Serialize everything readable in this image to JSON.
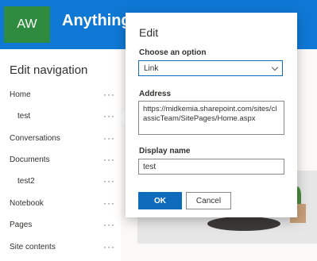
{
  "header": {
    "avatar_initials": "AW",
    "site_title": "Anything b"
  },
  "nav": {
    "title": "Edit navigation",
    "more_glyph": "···",
    "items": [
      {
        "label": "Home",
        "indent": false
      },
      {
        "label": "test",
        "indent": true
      },
      {
        "label": "Conversations",
        "indent": false
      },
      {
        "label": "Documents",
        "indent": false
      },
      {
        "label": "test2",
        "indent": true
      },
      {
        "label": "Notebook",
        "indent": false
      },
      {
        "label": "Pages",
        "indent": false
      },
      {
        "label": "Site contents",
        "indent": false
      }
    ]
  },
  "dialog": {
    "title": "Edit",
    "option_label": "Choose an option",
    "option_value": "Link",
    "address_label": "Address",
    "address_value": "https://midkemia.sharepoint.com/sites/classicTeam/SitePages/Home.aspx",
    "display_label": "Display name",
    "display_value": "test",
    "ok_label": "OK",
    "cancel_label": "Cancel"
  },
  "colors": {
    "accent": "#0f78d4",
    "avatar": "#2e8b3f",
    "primary_button": "#0f6cbd"
  }
}
